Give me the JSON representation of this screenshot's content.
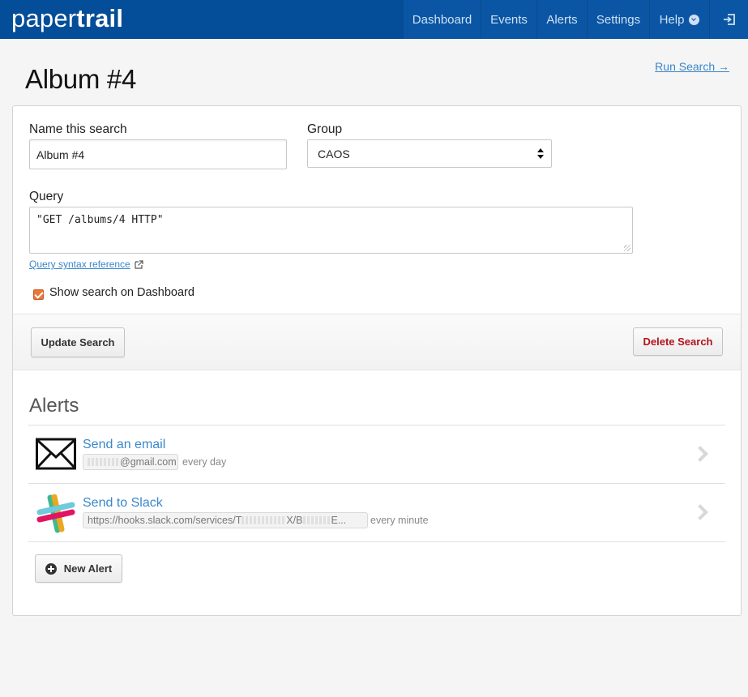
{
  "app": {
    "logo_regular": "paper",
    "logo_bold": "trail"
  },
  "nav": {
    "items": [
      {
        "label": "Dashboard"
      },
      {
        "label": "Events"
      },
      {
        "label": "Alerts"
      },
      {
        "label": "Settings"
      },
      {
        "label": "Help"
      }
    ],
    "help_icon": "chevron-down-circle-icon",
    "logout_icon": "sign-out-icon"
  },
  "page": {
    "title": "Album #4",
    "run_search_label": "Run Search →"
  },
  "form": {
    "name_label": "Name this search",
    "name_value": "Album #4",
    "group_label": "Group",
    "group_value": "CAOS",
    "query_label": "Query",
    "query_value": "\"GET /albums/4 HTTP\"",
    "syntax_link": "Query syntax reference",
    "dashboard_checkbox_label": "Show search on Dashboard",
    "dashboard_checkbox_checked": true
  },
  "actions": {
    "update_label": "Update Search",
    "delete_label": "Delete Search"
  },
  "alerts": {
    "title": "Alerts",
    "items": [
      {
        "icon": "envelope-icon",
        "title": "Send an email",
        "target": "@gmail.com",
        "frequency": "every day"
      },
      {
        "icon": "slack-icon",
        "title": "Send to Slack",
        "target_prefix": "https://hooks.slack.com/services/T",
        "target_mid": "X/B",
        "target_suffix": "E...",
        "frequency": "every minute"
      }
    ],
    "new_alert_label": "New Alert"
  },
  "colors": {
    "nav_bg": "#034d99",
    "link": "#3a87c9",
    "danger": "#b3131b",
    "checkbox": "#e8773a"
  }
}
